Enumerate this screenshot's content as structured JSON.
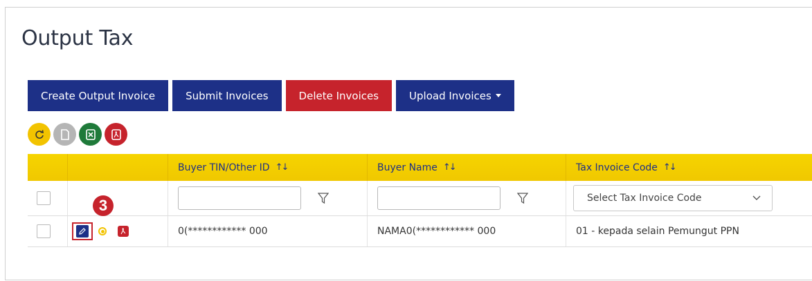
{
  "page": {
    "title": "Output Tax"
  },
  "toolbar": {
    "create_label": "Create Output Invoice",
    "submit_label": "Submit Invoices",
    "delete_label": "Delete Invoices",
    "upload_label": "Upload Invoices"
  },
  "icon_buttons": [
    "refresh-icon",
    "document-icon",
    "excel-icon",
    "pdf-icon"
  ],
  "colors": {
    "navy": "#1d3087",
    "red": "#c6232c",
    "yellow": "#f2c300",
    "green": "#1f7a3a",
    "gray": "#b5b5b5"
  },
  "table": {
    "columns": [
      "",
      "",
      "Buyer TIN/Other ID",
      "Buyer Name",
      "Tax Invoice Code"
    ],
    "filters": {
      "tax_code_placeholder": "Select Tax Invoice Code"
    },
    "rows": [
      {
        "buyer_tin": "0(************ 000",
        "buyer_name": "NAMA0(************ 000",
        "tax_code": "01 - kepada selain Pemungut PPN"
      }
    ]
  },
  "annotation": {
    "step": "3"
  }
}
